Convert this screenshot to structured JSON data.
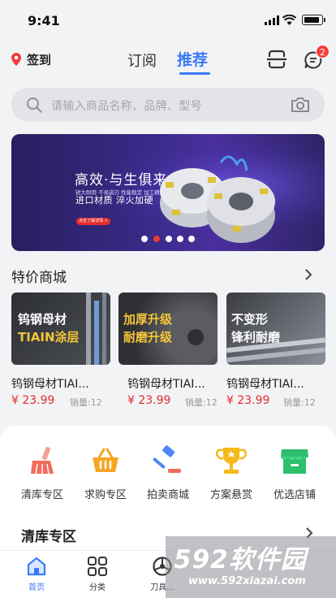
{
  "status_bar": {
    "time": "9:41"
  },
  "header": {
    "checkin_label": "签到",
    "tabs": [
      {
        "label": "订阅",
        "active": false
      },
      {
        "label": "推荐",
        "active": true
      }
    ],
    "message_badge": "2",
    "accent_color": "#3b7bf6"
  },
  "search": {
    "placeholder": "请输入商品名称、品牌、型号"
  },
  "banner": {
    "title": "高效·与生俱来",
    "tags": "锐大耐用  不易崩刃  性能稳定  加工精美",
    "subtitle": "进口材质 淬火加硬",
    "button": "点击了解详情 >",
    "dots": 5,
    "active_dot": 2
  },
  "special": {
    "title": "特价商城",
    "products": [
      {
        "img_line1": "钨钢母材",
        "img_line2": "TIAIN涂层",
        "name": "钨钢母材TIAI...",
        "price": "¥ 23.99",
        "sales": "销量:12"
      },
      {
        "img_line1": "加厚升级",
        "img_line2": "耐磨升级",
        "name": "钨钢母材TIAI...",
        "price": "¥ 23.99",
        "sales": "销量:12"
      },
      {
        "img_line1": "不变形",
        "img_line2": "锋利耐磨",
        "name": "钨钢母材TIAI...",
        "price": "¥ 23.99",
        "sales": "销量:12"
      }
    ]
  },
  "categories": [
    {
      "label": "清库专区",
      "icon": "broom-icon"
    },
    {
      "label": "求购专区",
      "icon": "basket-icon"
    },
    {
      "label": "拍卖商城",
      "icon": "gavel-icon"
    },
    {
      "label": "方案悬赏",
      "icon": "trophy-icon"
    },
    {
      "label": "优选店铺",
      "icon": "store-icon"
    }
  ],
  "clearance": {
    "title": "清库专区"
  },
  "tabbar": [
    {
      "label": "首页",
      "icon": "home-icon",
      "active": true
    },
    {
      "label": "分类",
      "icon": "grid-icon",
      "active": false
    },
    {
      "label": "刀具...",
      "icon": "wheel-icon",
      "active": false
    }
  ],
  "watermark": {
    "logo": "592软件园",
    "url": "www.592xiazai.com"
  }
}
